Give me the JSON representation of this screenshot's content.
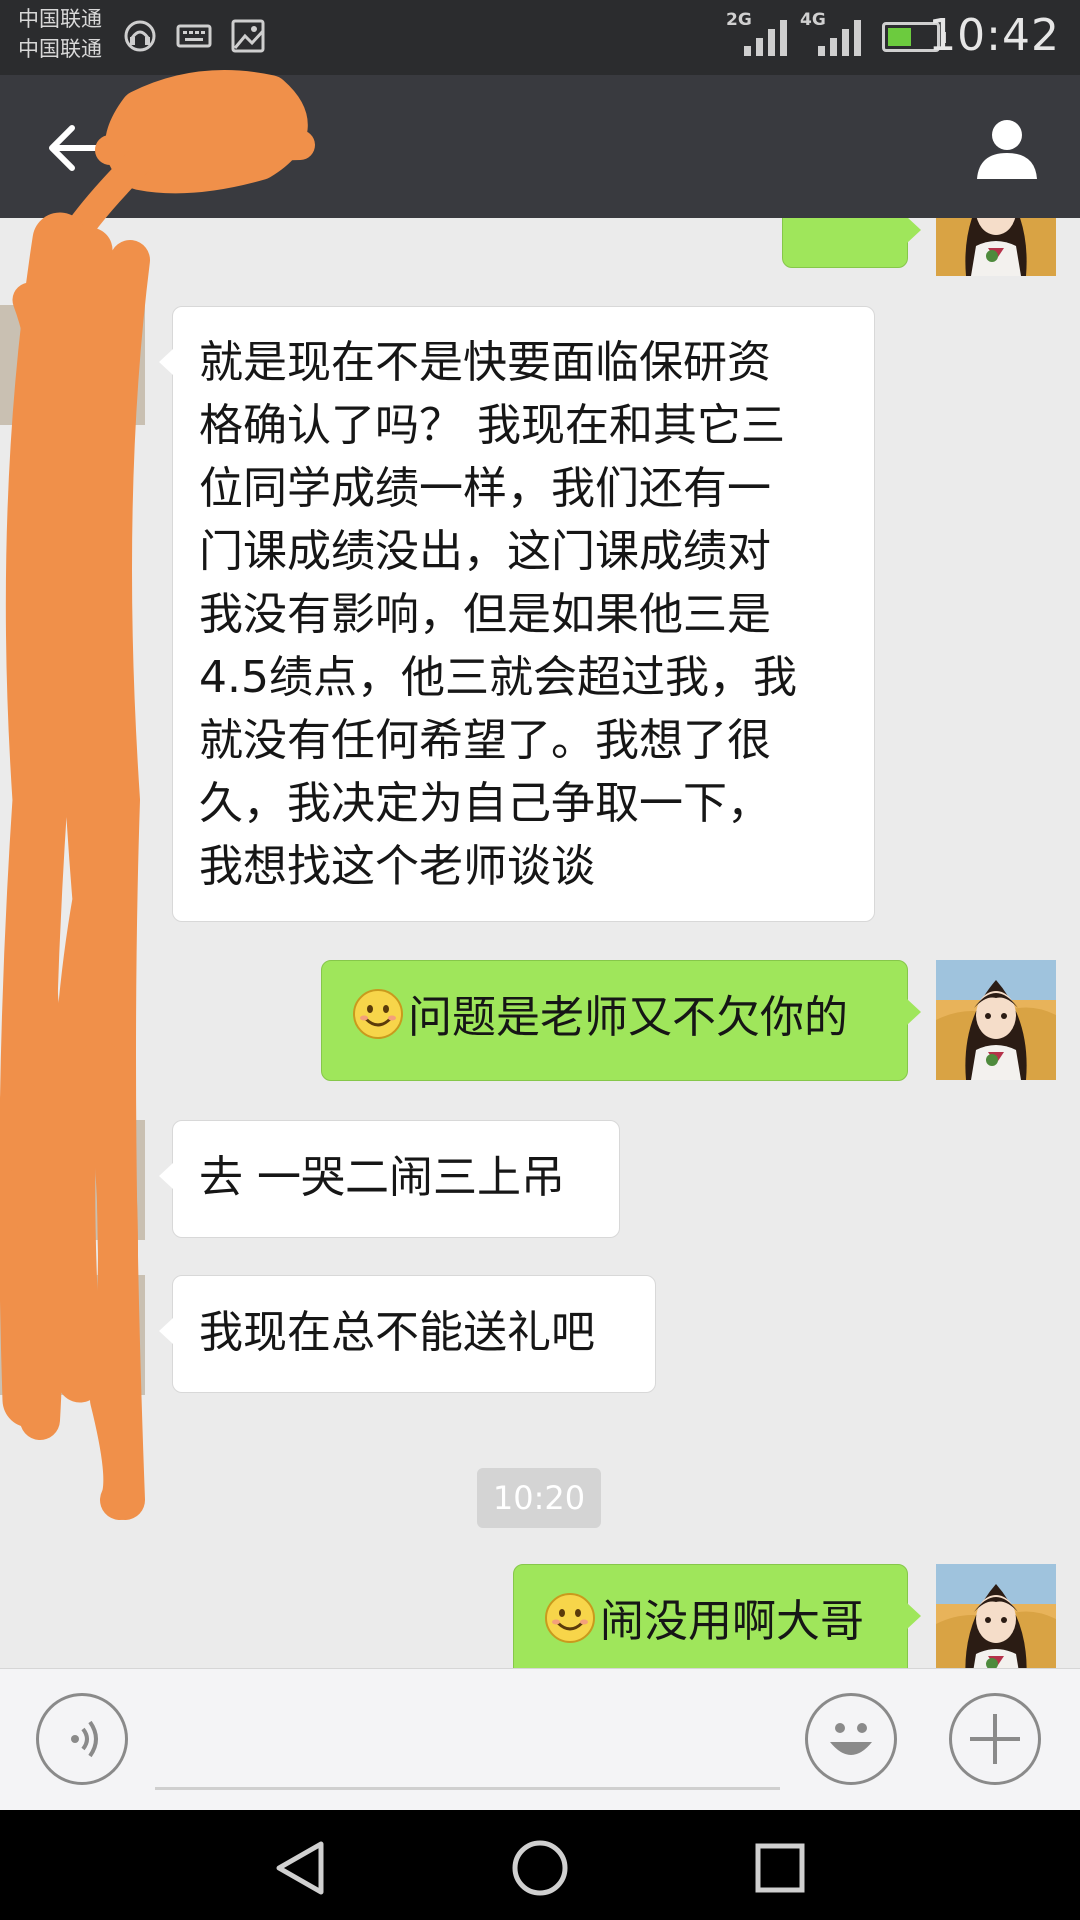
{
  "status_bar": {
    "carrier_1": "中国联通",
    "carrier_2": "中国联通",
    "network_1": "2G",
    "network_2": "4G",
    "time": "10:42",
    "battery_level": 0.5,
    "icons": [
      "headset-icon",
      "keyboard-icon",
      "image-icon",
      "signal-icon",
      "battery-icon"
    ]
  },
  "title_bar": {
    "contact_name": "",
    "icons": [
      "back-arrow-icon",
      "profile-icon"
    ]
  },
  "messages": [
    {
      "side": "in",
      "lines": [
        "就是现在不是快要面临保研资",
        "格确认了吗？ 我现在和其它三",
        "位同学成绩一样，我们还有一",
        "门课成绩没出，这门课成绩对",
        "我没有影响，但是如果他三是",
        "4.5绩点，他三就会超过我，我",
        "就没有任何希望了。我想了很",
        "久，我决定为自己争取一下，",
        "我想找这个老师谈谈"
      ]
    },
    {
      "side": "out",
      "emoji": "smile-emoji",
      "text": "问题是老师又不欠你的"
    },
    {
      "side": "in",
      "text": "去 一哭二闹三上吊"
    },
    {
      "side": "in",
      "text": "我现在总不能送礼吧"
    },
    {
      "side": "out",
      "emoji": "smile-emoji",
      "text": "闹没用啊大哥"
    }
  ],
  "timestamp": "10:20",
  "input_bar": {
    "icons": [
      "voice-icon",
      "emoji-icon",
      "plus-icon"
    ]
  },
  "nav_bar": {
    "icons": [
      "back-triangle-icon",
      "home-circle-icon",
      "recents-square-icon"
    ]
  },
  "colors": {
    "status_bar": "#2b2c2e",
    "title_bar": "#393a3f",
    "chat_bg": "#ebebeb",
    "bubble_out": "#9fe65b",
    "bubble_in": "#ffffff",
    "scribble": "#f0904a"
  }
}
